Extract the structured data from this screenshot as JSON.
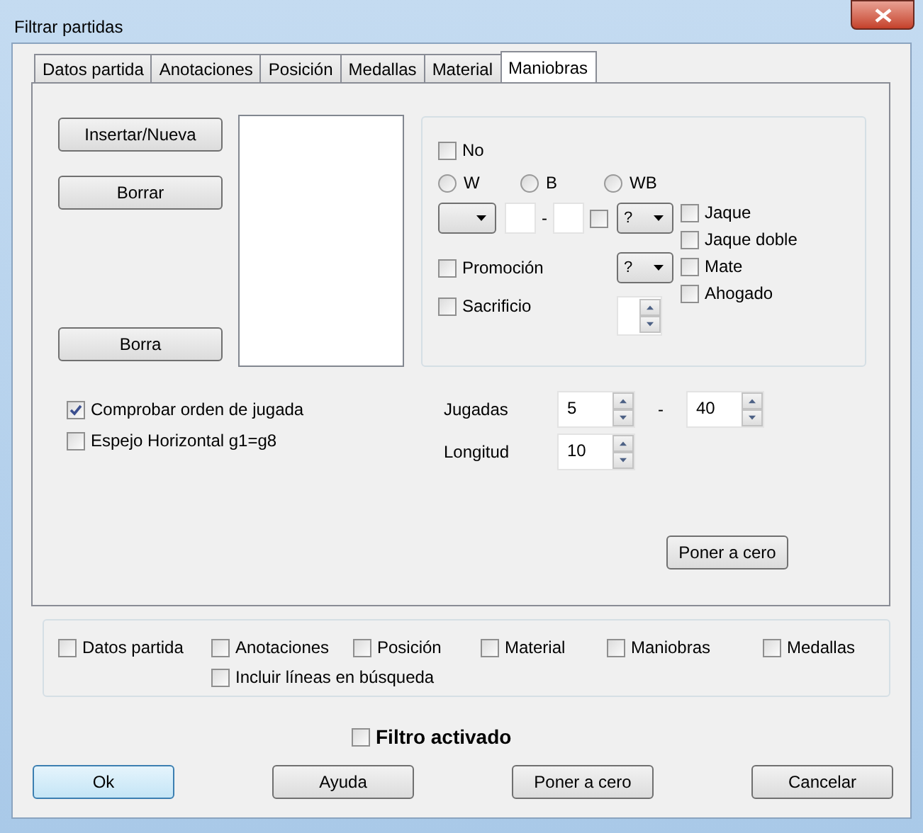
{
  "window": {
    "title": "Filtrar partidas"
  },
  "tabs": [
    {
      "label": "Datos partida",
      "selected": false
    },
    {
      "label": "Anotaciones",
      "selected": false
    },
    {
      "label": "Posición",
      "selected": false
    },
    {
      "label": "Medallas",
      "selected": false
    },
    {
      "label": "Material",
      "selected": false
    },
    {
      "label": "Maniobras",
      "selected": true
    }
  ],
  "move_buttons": [
    {
      "label": "Insertar/Nueva"
    },
    {
      "label": "Borrar"
    },
    {
      "label": "Borra"
    }
  ],
  "move_panel": {
    "no": {
      "label": "No",
      "checked": false
    },
    "side": [
      {
        "label": "W",
        "selected": false
      },
      {
        "label": "B",
        "selected": false
      },
      {
        "label": "WB",
        "selected": false
      }
    ],
    "capture": {
      "checked": false
    },
    "dash": "-",
    "result_combo": "?",
    "promotion": {
      "label": "Promoción",
      "checked": false
    },
    "promotion_combo": "?",
    "sacrifice": {
      "label": "Sacrificio",
      "checked": false
    },
    "checks": [
      {
        "label": "Jaque",
        "checked": false
      },
      {
        "label": "Jaque doble",
        "checked": false
      },
      {
        "label": "Mate",
        "checked": false
      },
      {
        "label": "Ahogado",
        "checked": false
      }
    ]
  },
  "options": [
    {
      "label": "Comprobar orden de jugada",
      "checked": true
    },
    {
      "label": "Espejo Horizontal g1=g8",
      "checked": false
    }
  ],
  "moves": {
    "label": "Jugadas",
    "from": "5",
    "dash": "-",
    "to": "40"
  },
  "length": {
    "label": "Longitud",
    "value": "10"
  },
  "reset_tab": "Poner a cero",
  "scope": [
    {
      "label": "Datos partida",
      "checked": false
    },
    {
      "label": "Anotaciones",
      "checked": false
    },
    {
      "label": "Posición",
      "checked": false
    },
    {
      "label": "Material",
      "checked": false
    },
    {
      "label": "Maniobras",
      "checked": false
    },
    {
      "label": "Medallas",
      "checked": false
    }
  ],
  "include_lines": {
    "label": "Incluir líneas en búsqueda",
    "checked": false
  },
  "filter_active": {
    "label": "Filtro activado",
    "checked": false
  },
  "buttons": [
    {
      "label": "Ok",
      "default": true
    },
    {
      "label": "Ayuda",
      "default": false
    },
    {
      "label": "Poner a cero",
      "default": false
    },
    {
      "label": "Cancelar",
      "default": false
    }
  ]
}
